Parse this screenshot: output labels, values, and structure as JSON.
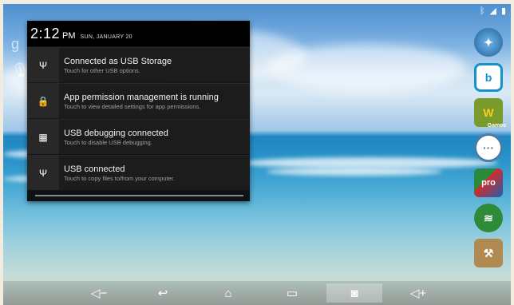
{
  "status_bar": {
    "icons": [
      "bluetooth-icon",
      "wifi-icon",
      "battery-icon"
    ]
  },
  "notification_shade": {
    "time": "2:12",
    "ampm": "PM",
    "date": "SUN, JANUARY 20",
    "notifications": [
      {
        "icon": "usb-icon",
        "title": "Connected as USB Storage",
        "subtitle": "Touch for other USB options."
      },
      {
        "icon": "lock-icon",
        "title": "App permission management is running",
        "subtitle": "Touch to view detailed settings for app permissions."
      },
      {
        "icon": "debug-icon",
        "title": "USB debugging connected",
        "subtitle": "Touch to disable USB debugging."
      },
      {
        "icon": "usb-icon",
        "title": "USB connected",
        "subtitle": "Touch to copy files to/from your computer."
      }
    ]
  },
  "dock_apps": [
    {
      "icon": "globe-app-icon",
      "color": "#2f7fc0"
    },
    {
      "icon": "b-app-icon",
      "color": "#1592c9",
      "glyph": "b"
    },
    {
      "icon": "w-games-app-icon",
      "color": "#6a8f2a",
      "glyph": "W",
      "badge": "Games"
    },
    {
      "icon": "dots-app-icon",
      "color": "#3d6a8a",
      "glyph": "···"
    },
    {
      "icon": "pro-app-icon",
      "color": "#c92a2a",
      "glyph": "pro"
    },
    {
      "icon": "wifi-shield-app-icon",
      "color": "#2e8b3a"
    },
    {
      "icon": "toolbox-app-icon",
      "color": "#8a6a3a"
    }
  ],
  "nav_bar": {
    "buttons": [
      {
        "name": "volume-down-button",
        "glyph": "◁−"
      },
      {
        "name": "back-button",
        "glyph": "↩"
      },
      {
        "name": "home-button",
        "glyph": "⌂"
      },
      {
        "name": "recent-apps-button",
        "glyph": "▭"
      },
      {
        "name": "screenshot-button",
        "glyph": "◙"
      },
      {
        "name": "volume-up-button",
        "glyph": "◁+"
      }
    ]
  },
  "left_search": {
    "search_icon": "google-search-icon",
    "voice_icon": "microphone-icon"
  }
}
